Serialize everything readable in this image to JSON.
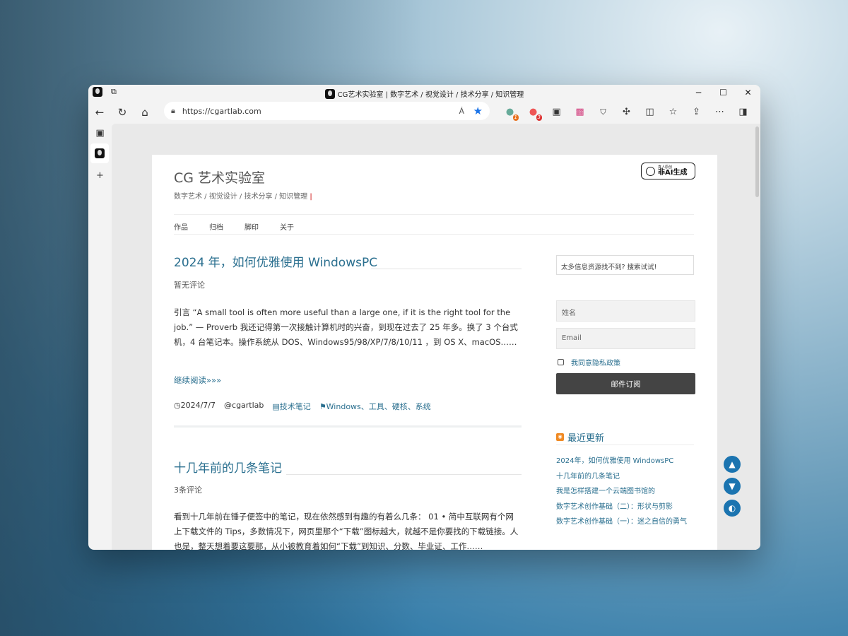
{
  "window": {
    "title": "CG艺术实验室 | 数字艺术 / 视觉设计 / 技术分享 / 知识管理",
    "controls": {
      "minimize": "─",
      "maximize": "☐",
      "close": "✕"
    }
  },
  "browser": {
    "url": "https://cgartlab.com",
    "read_aloud": "Á",
    "extension_badges": {
      "ext1": "1",
      "ext2": "3"
    }
  },
  "site": {
    "title": "CG 艺术实验室",
    "description": "数字艺术 / 视觉设计 / 技术分享 / 知识管理",
    "caret": "|",
    "badge_small": "真人原创",
    "badge_big": "非AI生成",
    "menu": [
      "作品",
      "归档",
      "脚印",
      "关于"
    ]
  },
  "posts": [
    {
      "title": "2024 年，如何优雅使用 WindowsPC",
      "comments": "暂无评论",
      "excerpt": "引言 “A small tool is often more useful than a large one, if it is the right tool for the job.” — Proverb 我还记得第一次接触计算机时的兴奋，到现在过去了 25 年多。换了 3 个台式机，4 台笔记本。操作系统从 DOS、Windows95/98/XP/7/8/10/11 ，到 OS X、macOS……",
      "readmore": "继续阅读»»»",
      "date": "◷2024/7/7",
      "author": "@cgartlab",
      "category": "▤技术笔记",
      "tags": "⚑Windows、工具、硬核、系统"
    },
    {
      "title": "十几年前的几条笔记",
      "comments": "3条评论",
      "excerpt": "看到十几年前在锤子便签中的笔记，现在依然感到有趣的有着么几条： 01 • 简中互联网有个网上下载文件的 Tips，多数情况下，网页里那个“下载”图标越大，就越不是你要找的下载链接。人也是，整天想着要这要那，从小被教育着如何“下载”到知识、分数、毕业证、工作……"
    }
  ],
  "sidebar": {
    "search_placeholder": "太多信息资源找不到? 搜索试试!",
    "name_placeholder": "姓名",
    "email_placeholder": "Email",
    "agree_label": "我同意隐私政策",
    "subscribe_label": "邮件订阅",
    "recent_title": "最近更新",
    "recent_items": [
      "2024年，如何优雅使用 WindowsPC",
      "十几年前的几条笔记",
      "我是怎样搭建一个云端图书馆的",
      "数字艺术创作基础（二）：形状与剪影",
      "数字艺术创作基础（一）：迷之自信的勇气"
    ]
  },
  "float_buttons": {
    "up": "▲",
    "down": "▼",
    "theme": "◐"
  },
  "colors": {
    "link": "#2a6f8f",
    "float": "#1b74b0",
    "subscribe_bg": "#444444"
  }
}
